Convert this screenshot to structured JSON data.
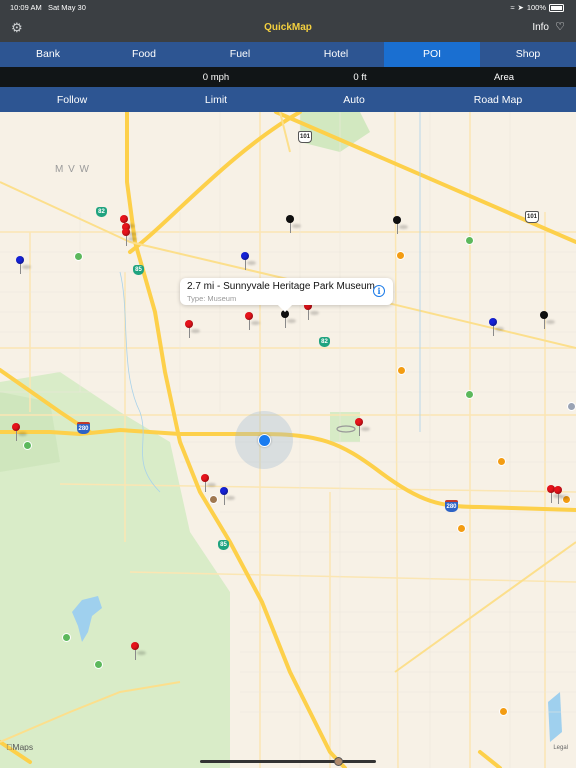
{
  "status_bar": {
    "time": "10:09 AM",
    "date": "Sat May 30",
    "battery": "100%"
  },
  "nav": {
    "title": "QuickMap",
    "info_label": "Info",
    "settings_icon": "gear-icon",
    "favorite_icon": "heart-icon"
  },
  "categories": {
    "tabs": [
      {
        "label": "Bank",
        "active": false
      },
      {
        "label": "Food",
        "active": false
      },
      {
        "label": "Fuel",
        "active": false
      },
      {
        "label": "Hotel",
        "active": false
      },
      {
        "label": "POI",
        "active": true
      },
      {
        "label": "Shop",
        "active": false
      }
    ]
  },
  "info_bar": {
    "speed": "0 mph",
    "altitude": "0 ft",
    "area": "Area"
  },
  "controls": {
    "follow": "Follow",
    "limit": "Limit",
    "auto": "Auto",
    "map_type": "Road Map"
  },
  "map": {
    "callout": {
      "title": "2.7 mi - Sunnyvale Heritage Park Museum",
      "subtitle": "Type: Museum"
    },
    "city_label": "M V W",
    "route_shields": [
      "82",
      "85",
      "101",
      "101",
      "82",
      "280",
      "280",
      "85"
    ],
    "attribution": "Maps",
    "legal": "Legal",
    "pin_colors": {
      "red": "#e8131b",
      "blue": "#1522d8",
      "black": "#111111"
    }
  },
  "colors": {
    "nav_bg": "#3b3f43",
    "title_yellow": "#f4d03f",
    "bar_blue": "#2d5592",
    "active_tab": "#1a6fd1",
    "info_bg": "#111517",
    "land": "#f7f1e6",
    "highway": "#fdd04a"
  }
}
